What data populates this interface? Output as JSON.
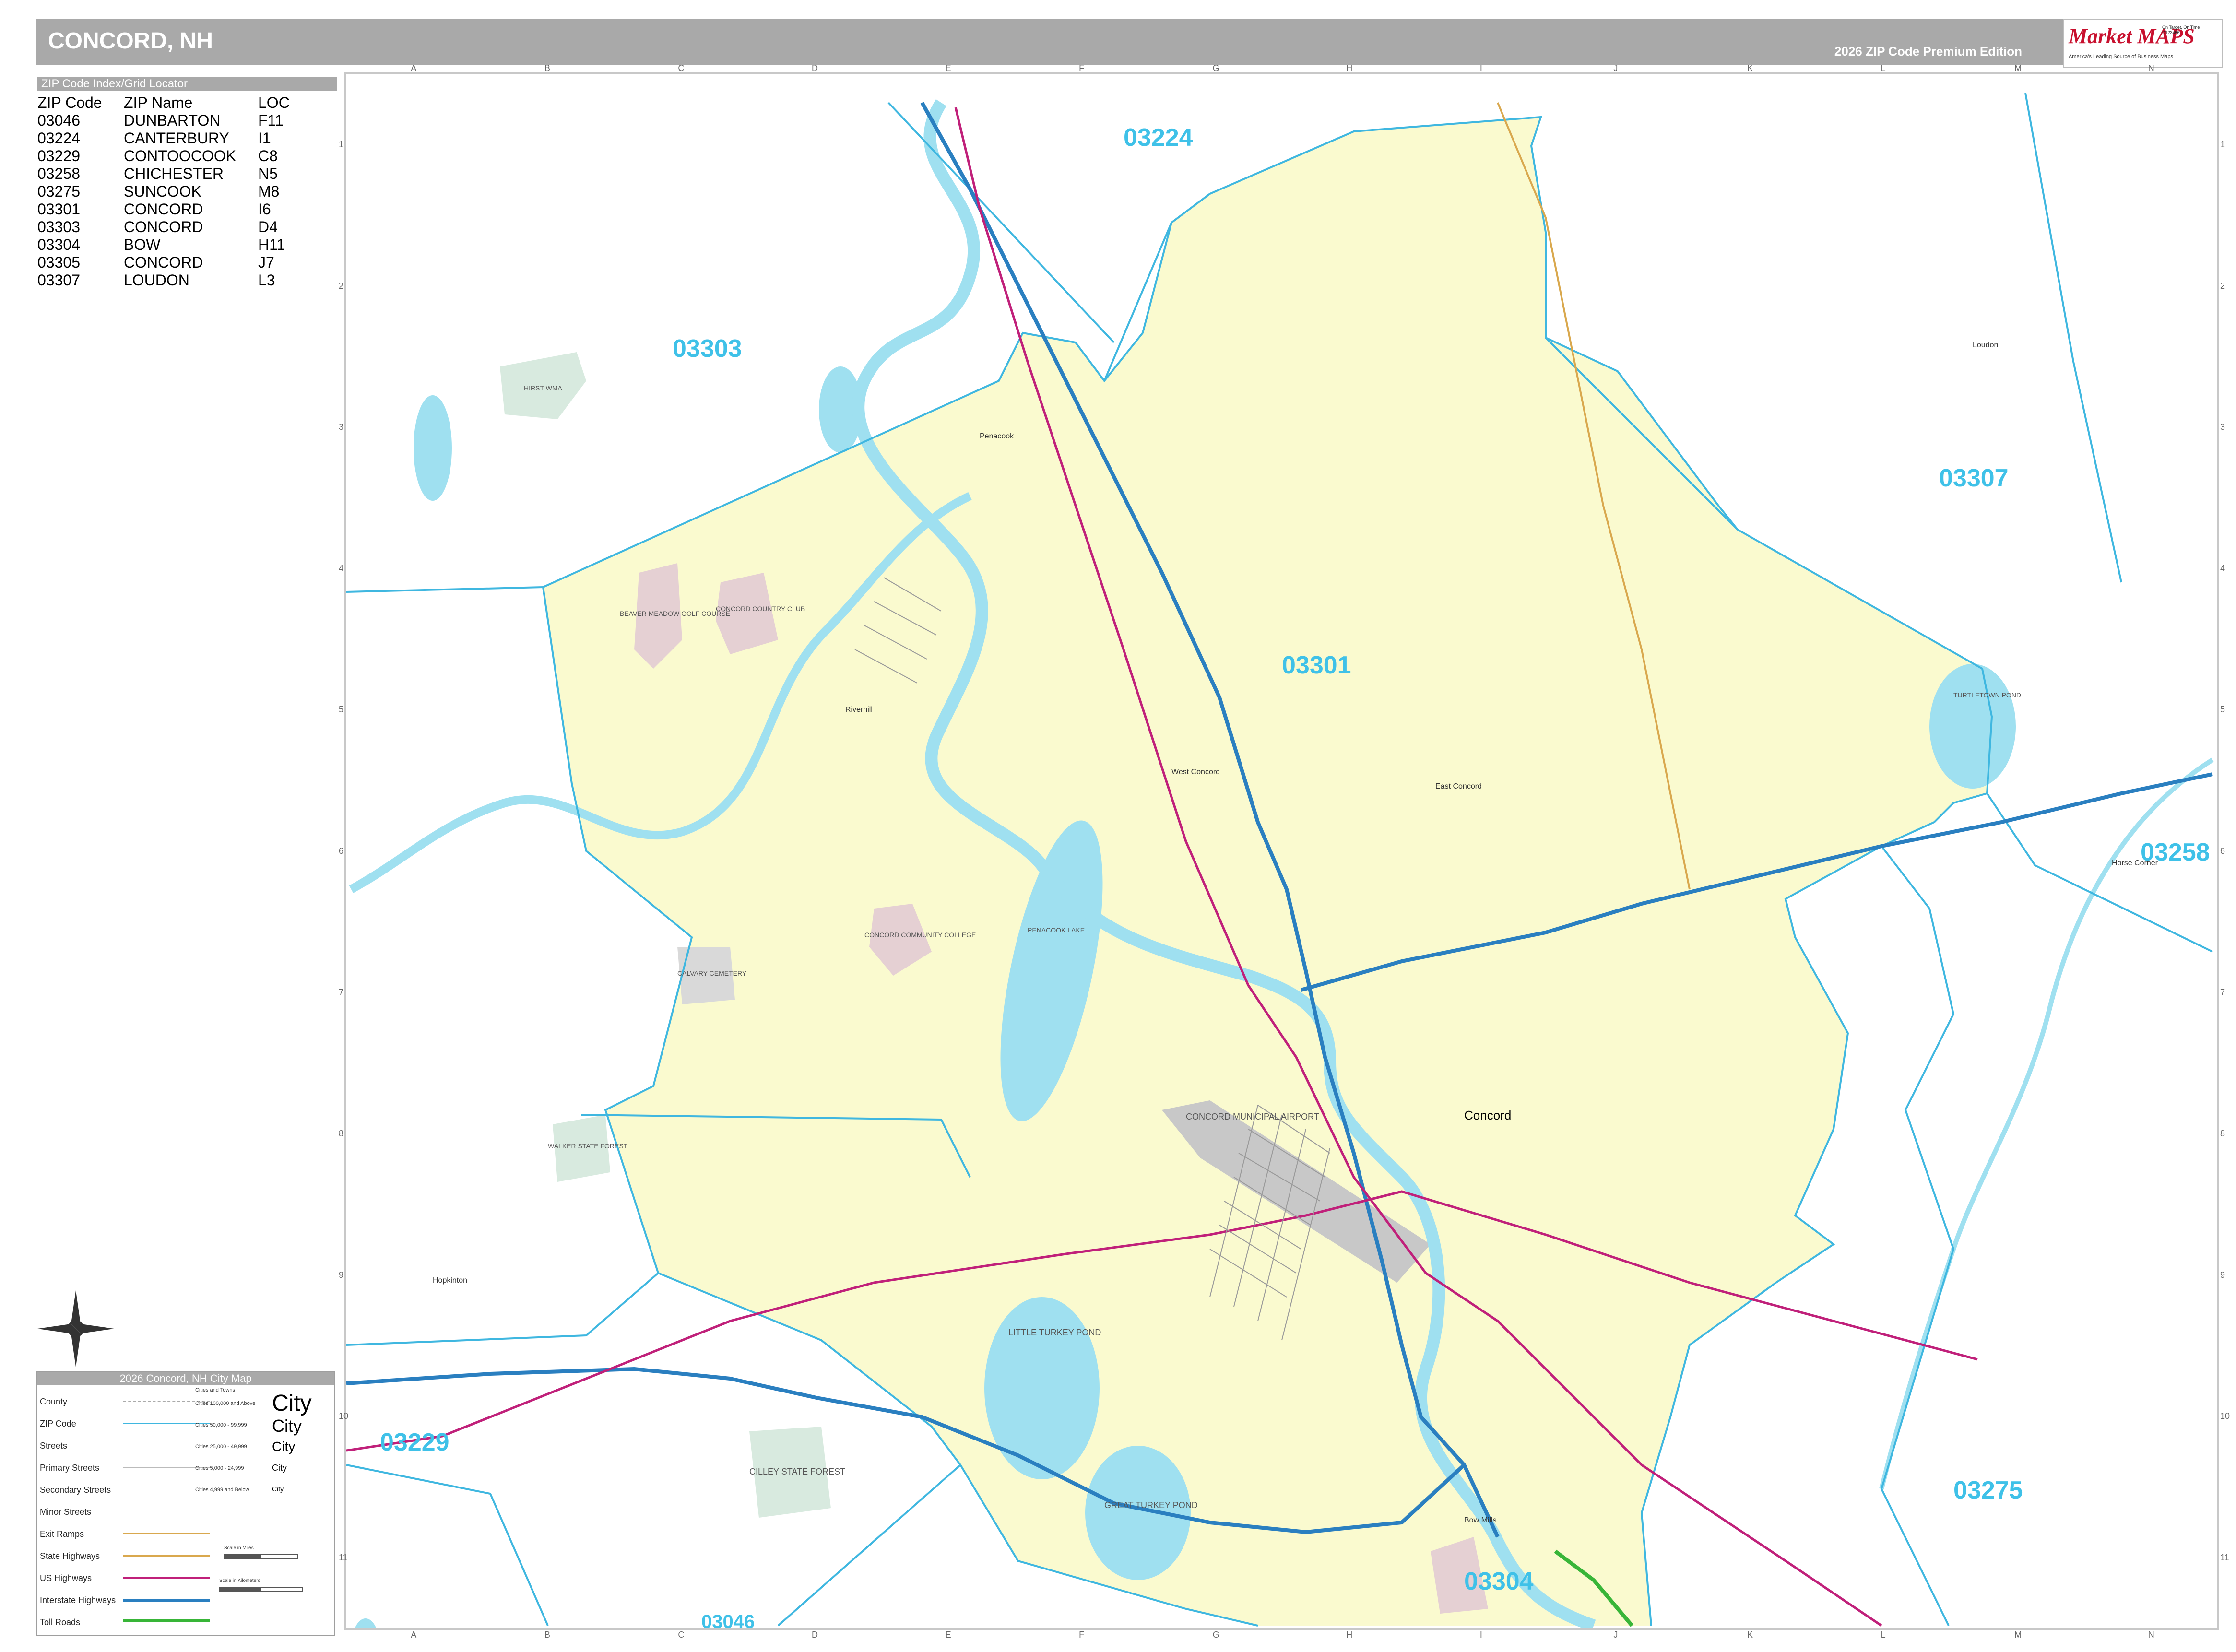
{
  "header": {
    "title": "CONCORD, NH",
    "edition": "2026 ZIP Code Premium Edition",
    "logo": {
      "name": "Market MAPS",
      "tagline": "On Target, On Time",
      "subtitle": "America's Leading Source of Business Maps",
      "product_code": "D123456"
    }
  },
  "index": {
    "heading": "ZIP Code Index/Grid Locator",
    "columns": [
      "ZIP Code",
      "ZIP Name",
      "LOC"
    ],
    "rows": [
      [
        "03046",
        "DUNBARTON",
        "F11"
      ],
      [
        "03224",
        "CANTERBURY",
        "I1"
      ],
      [
        "03229",
        "CONTOOCOOK",
        "C8"
      ],
      [
        "03258",
        "CHICHESTER",
        "N5"
      ],
      [
        "03275",
        "SUNCOOK",
        "M8"
      ],
      [
        "03301",
        "CONCORD",
        "I6"
      ],
      [
        "03303",
        "CONCORD",
        "D4"
      ],
      [
        "03304",
        "BOW",
        "H11"
      ],
      [
        "03305",
        "CONCORD",
        "J7"
      ],
      [
        "03307",
        "LOUDON",
        "L3"
      ]
    ]
  },
  "grid": {
    "columns": [
      "A",
      "B",
      "C",
      "D",
      "E",
      "F",
      "G",
      "H",
      "I",
      "J",
      "K",
      "L",
      "M",
      "N"
    ],
    "rows": [
      "1",
      "2",
      "3",
      "4",
      "5",
      "6",
      "7",
      "8",
      "9",
      "10",
      "11"
    ]
  },
  "map": {
    "zip_labels": [
      "03224",
      "03303",
      "03301",
      "03307",
      "03258",
      "03229",
      "03275",
      "03304",
      "03046"
    ],
    "places": [
      "Penacook",
      "Riverhill",
      "West Concord",
      "East Concord",
      "Concord",
      "Loudon",
      "Horse Corner",
      "Hopkinton",
      "Bow Mills"
    ],
    "pois": [
      "HIRST WMA",
      "BEAVER MEADOW GOLF COURSE",
      "CONCORD COUNTRY CLUB",
      "TURTLETOWN POND",
      "PENACOOK LAKE",
      "CALVARY CEMETERY",
      "CONCORD COMMUNITY COLLEGE",
      "WALKER STATE FOREST",
      "CONCORD MUNICIPAL AIRPORT",
      "LITTLE TURKEY POND",
      "GREAT TURKEY POND",
      "CILLEY STATE FOREST"
    ],
    "colors": {
      "zip_fill": "#fafacf",
      "zip_boundary": "#3fb7e0",
      "water": "#9fe0f0",
      "park": "#d8eadf",
      "institution": "#e5d0d3",
      "interstate": "#2a7fc0",
      "us_highway": "#c0207a",
      "state_highway": "#d9a84e",
      "toll_road": "#38b538"
    }
  },
  "legend": {
    "title": "2026 Concord, NH City Map",
    "items": [
      "County",
      "ZIP Code",
      "Streets",
      "Primary Streets",
      "Secondary Streets",
      "Minor Streets",
      "Exit Ramps",
      "State Highways",
      "US Highways",
      "Interstate Highways",
      "Toll Roads"
    ],
    "cities_heading": "Cities and Towns",
    "city_sizes": [
      "Cities 100,000 and Above",
      "Cities 50,000 - 99,999",
      "Cities 25,000 - 49,999",
      "Cities 5,000 - 24,999",
      "Cities 4,999 and Below"
    ],
    "city_samples": [
      "City",
      "City",
      "City",
      "City",
      "City"
    ],
    "scale_miles": "Scale in Miles",
    "scale_km": "Scale in Kilometers"
  }
}
